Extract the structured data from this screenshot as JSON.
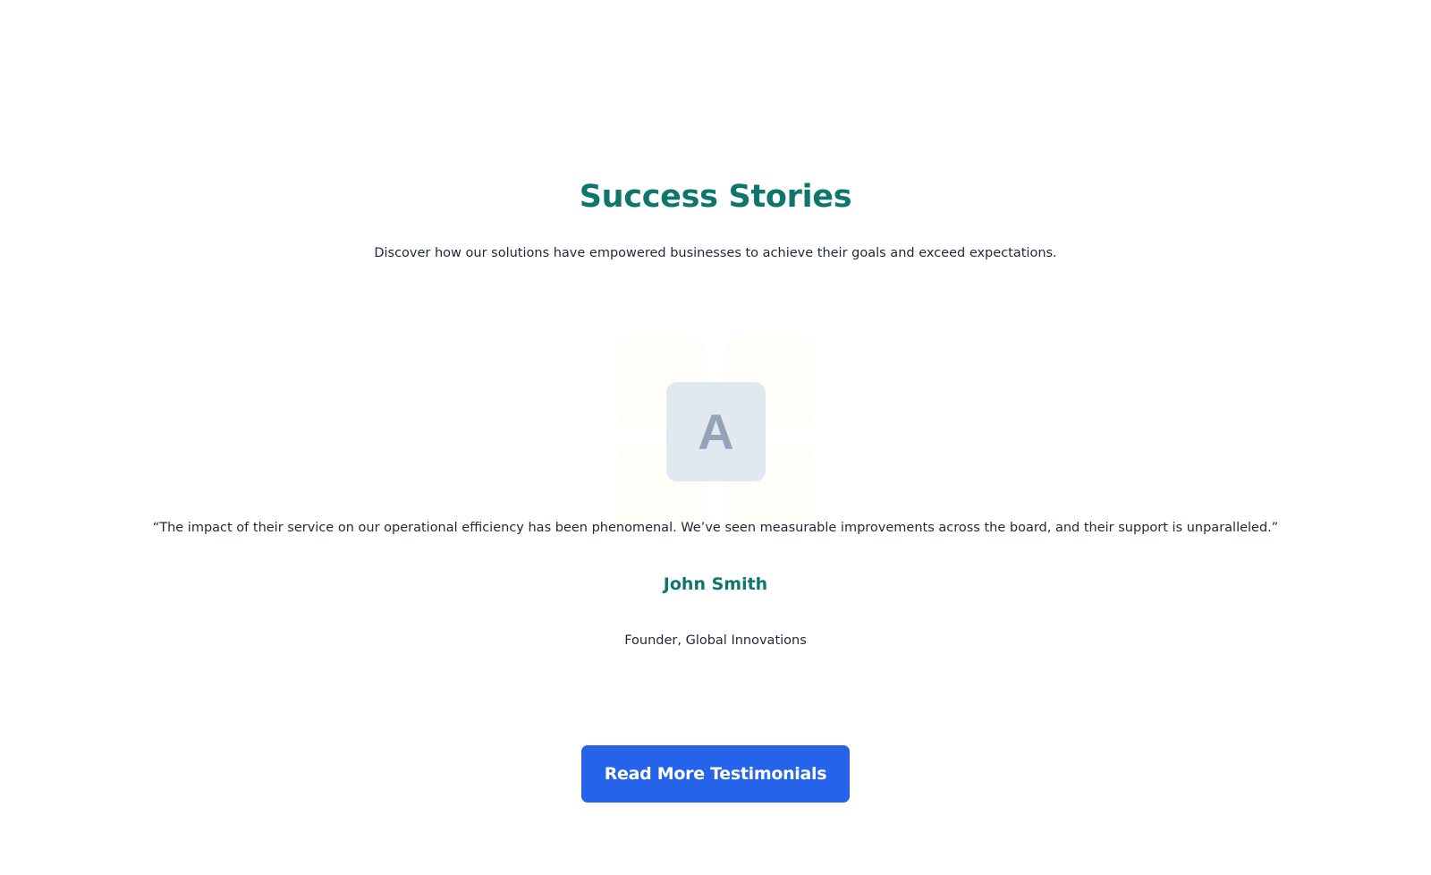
{
  "section": {
    "title": "Success Stories",
    "subtitle": "Discover how our solutions have empowered businesses to achieve their goals and exceed expectations."
  },
  "testimonial": {
    "avatar_letter": "A",
    "quote": "“The impact of their service on our operational efficiency has been phenomenal. We’ve seen measurable improvements across the board, and their support is unparalleled.”",
    "author_name": "John Smith",
    "author_role": "Founder, Global Innovations"
  },
  "cta": {
    "label": "Read More Testimonials"
  },
  "colors": {
    "accent": "#0f766e",
    "button": "#2563eb",
    "text": "#1f2937",
    "avatar_bg": "#e2e8f0",
    "avatar_text": "#94a3b8"
  }
}
